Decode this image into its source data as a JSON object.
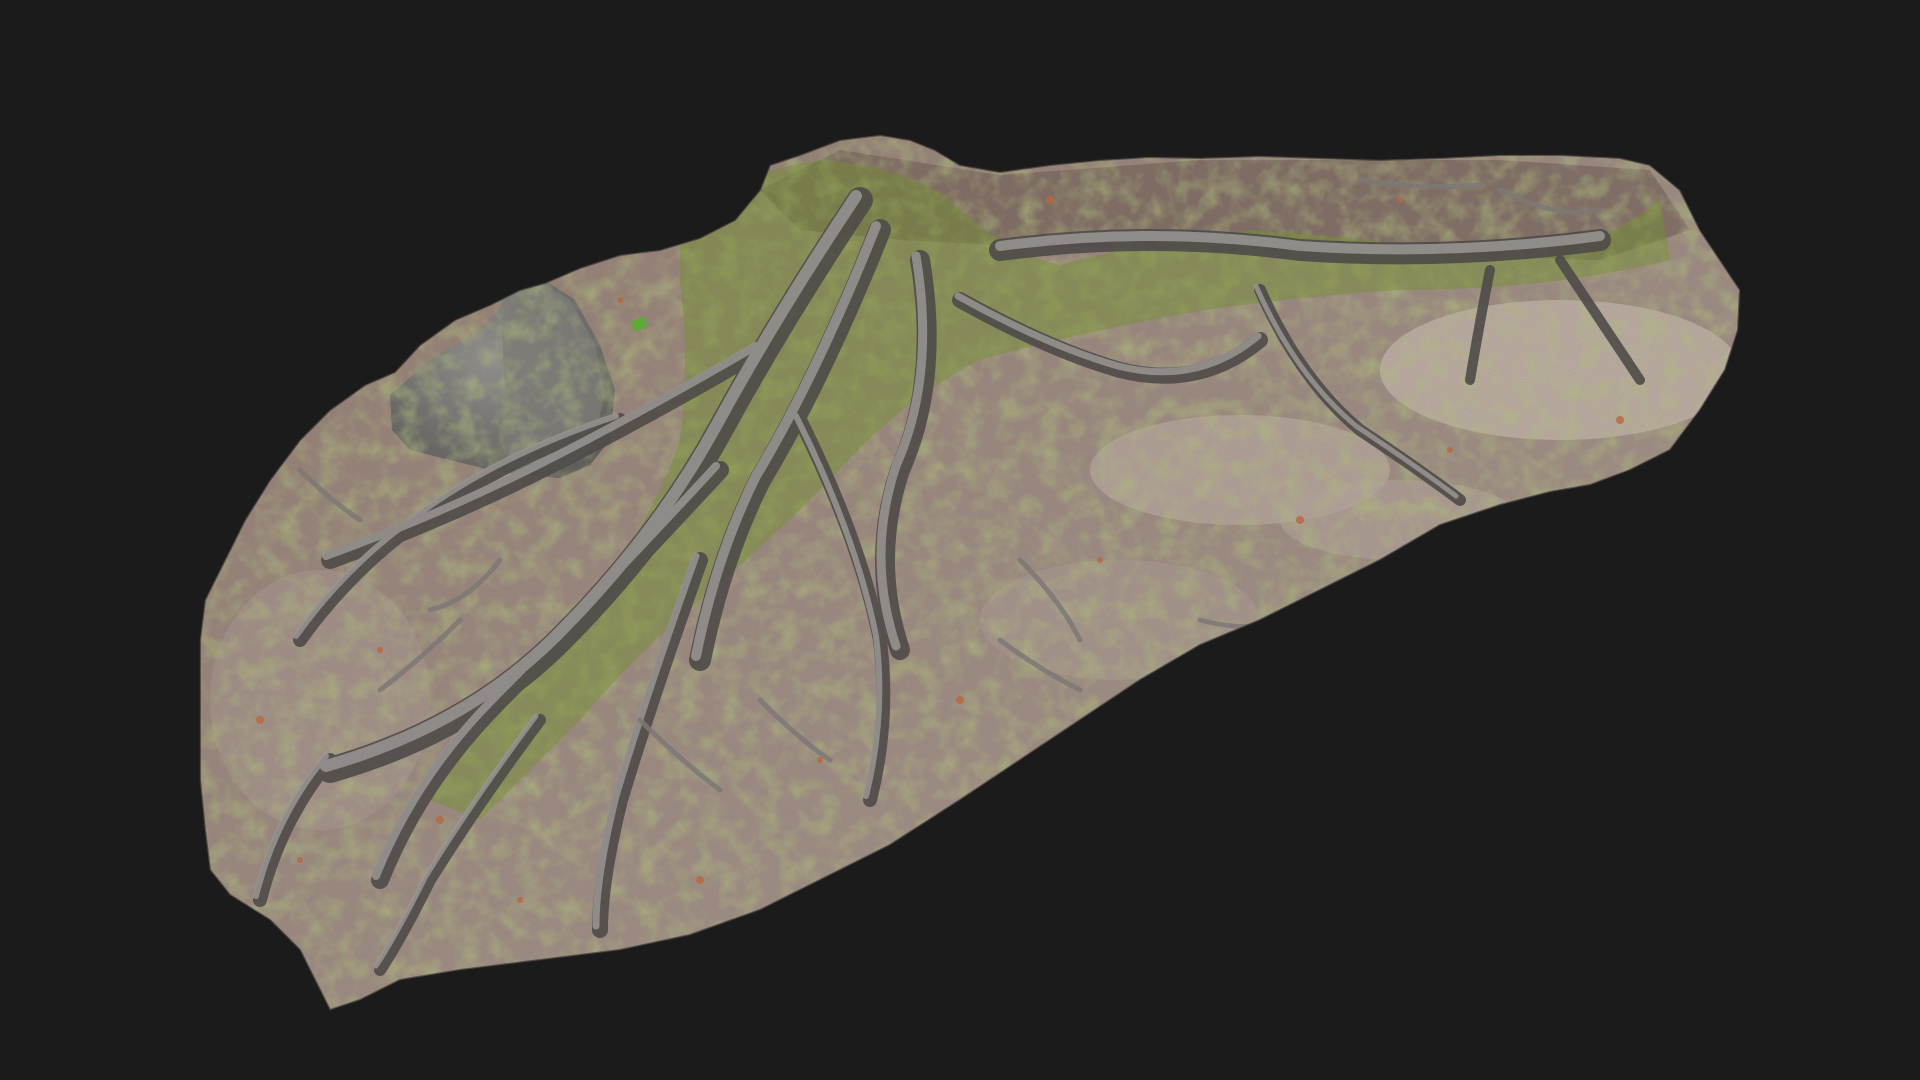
{
  "scene": {
    "background_color": "#1b1b1b",
    "subject": "photogrammetry-scan",
    "palette": {
      "ground": "#8f8480",
      "ground_light": "#b8b1ad",
      "sand": "#c9c2bc",
      "leaf_litter": "#9a5a3e",
      "leaf_bright": "#b8673f",
      "moss": "#6f8a2e",
      "moss_light": "#8fa33c",
      "root": "#8a8684",
      "root_dark": "#5a5654",
      "rock": "#6e6d6b",
      "rock_light": "#8e8c89"
    }
  }
}
